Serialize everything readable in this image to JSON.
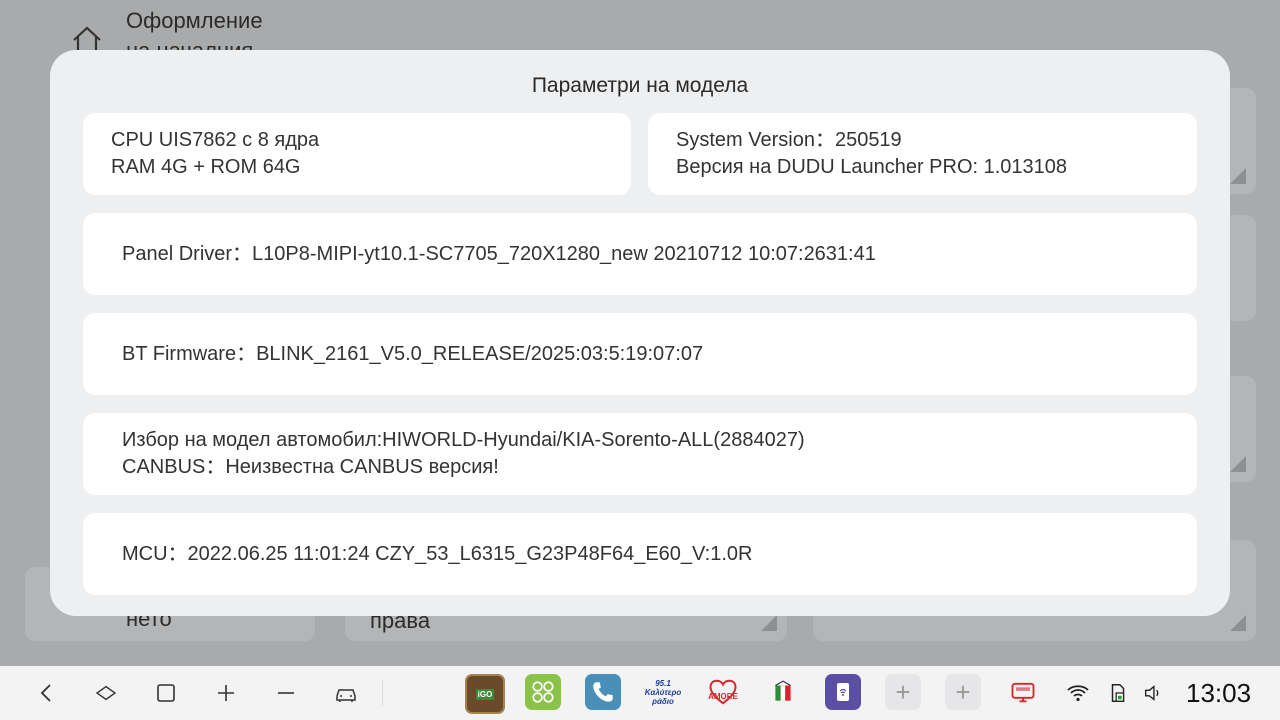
{
  "background": {
    "title_line1": "Оформление",
    "title_line2": "на началния",
    "bottom_left_text": "нето",
    "bottom_mid_text": "права"
  },
  "modal": {
    "title": "Параметри на модела",
    "cpu": "CPU UIS7862 с 8 ядра",
    "memory": "RAM 4G + ROM 64G",
    "system_version": "System Version：250519",
    "launcher_version": "Версия на DUDU Launcher PRO: 1.013108",
    "panel_driver": "Panel Driver：L10P8-MIPI-yt10.1-SC7705_720X1280_new 20210712 10:07:2631:41",
    "bt_firmware": "BT Firmware：BLINK_2161_V5.0_RELEASE/2025:03:5:19:07:07",
    "car_model": "Избор на модел автомобил:HIWORLD-Hyundai/KIA-Sorento-ALL(2884027)",
    "canbus": "CANBUS：Неизвестна CANBUS версия!",
    "mcu": "MCU：2022.06.25 11:01:24 CZY_53_L6315_G23P48F64_E60_V:1.0R"
  },
  "navbar": {
    "back_icon": "back-icon",
    "home_icon": "home-icon",
    "recents_icon": "recents-icon",
    "volume_up_icon": "plus-icon",
    "volume_down_icon": "minus-icon",
    "car_icon": "car-icon",
    "apps": {
      "igo": "iGO",
      "radio951": "95.1 Καλύτερο ράδιο",
      "amore": "AMORE",
      "plus_slot_1": "+",
      "plus_slot_2": "+"
    },
    "clock": "13:03"
  },
  "colors": {
    "overlay_bg": "#a9aaab",
    "modal_bg": "#eeeff1",
    "card_bg": "#ffffff",
    "navbar_bg": "#f3f3f4",
    "app_green": "#8bc34a",
    "app_phone": "#4a8fb8",
    "app_purple": "#5b4fa3"
  }
}
